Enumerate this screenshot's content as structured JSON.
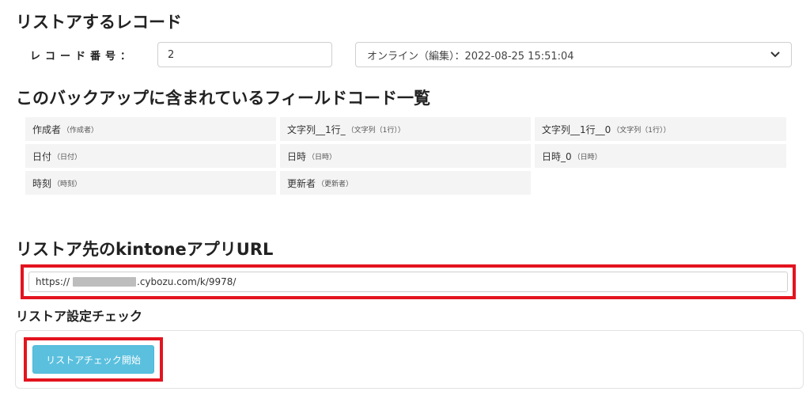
{
  "record_section": {
    "title": "リストアするレコード",
    "record_number_label": "レコード番号：",
    "record_number_value": "2",
    "version_select": {
      "selected": "オンライン（編集）：2022-08-25 15:51:04"
    }
  },
  "fields_section": {
    "title": "このバックアップに含まれているフィールドコード一覧",
    "fields": [
      {
        "code": "作成者",
        "type": "（作成者）"
      },
      {
        "code": "文字列__1行_",
        "type": "（文字列（1行））"
      },
      {
        "code": "文字列__1行__0",
        "type": "（文字列（1行））"
      },
      {
        "code": "日付",
        "type": "（日付）"
      },
      {
        "code": "日時",
        "type": "（日時）"
      },
      {
        "code": "日時_0",
        "type": "（日時）"
      },
      {
        "code": "時刻",
        "type": "（時刻）"
      },
      {
        "code": "更新者",
        "type": "（更新者）"
      }
    ]
  },
  "url_section": {
    "title": "リストア先のkintoneアプリURL",
    "url_prefix": "https://",
    "url_suffix": ".cybozu.com/k/9978/"
  },
  "check_section": {
    "title": "リストア設定チェック",
    "start_button_label": "リストアチェック開始"
  },
  "colors": {
    "highlight": "#e3141f",
    "button": "#5bc0de"
  }
}
